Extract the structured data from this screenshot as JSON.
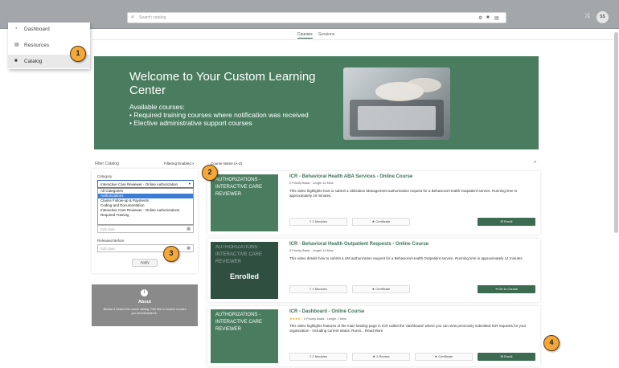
{
  "topbar": {
    "search_placeholder": "Search catalog",
    "right_icons": [
      "shuffle-icon",
      "avatar"
    ],
    "avatar_initials": "SS"
  },
  "sidebar": {
    "items": [
      {
        "label": "Dashboard",
        "icon": "dashboard-icon"
      },
      {
        "label": "Resources",
        "icon": "resources-icon"
      },
      {
        "label": "Catalog",
        "icon": "folder-icon"
      }
    ]
  },
  "tabs": [
    {
      "label": "Courses",
      "active": true
    },
    {
      "label": "Sessions",
      "active": false
    }
  ],
  "hero": {
    "title": "Welcome to Your Custom Learning Center",
    "subtitle": "Available courses:",
    "bullets": [
      "• Required training courses where notification was received",
      "• Elective administrative support courses"
    ]
  },
  "filter": {
    "title": "Filter Catalog",
    "filtering_label": "Filtering Enabled",
    "sort_label": "Course Name (A-Z)",
    "category_label": "Category",
    "selected_category": "Interactive Care Reviewer - Online Authorization",
    "options": [
      "All Categories",
      "Authorizations",
      "Claims Follow-up & Payments",
      "Coding and Documentation",
      "Interactive Care Reviewer - Online Authorizations",
      "Required Training"
    ],
    "highlighted_option": 1,
    "date_placeholder_1": "Edit date",
    "released_before_label": "Released Before",
    "date_placeholder_2": "Edit date",
    "apply_label": "Apply"
  },
  "about": {
    "title": "About",
    "description": "Browse & Search the course catalog. Feel free to enroll in courses you are interested in."
  },
  "courses": [
    {
      "thumb_text": "AUTHORIZATIONS - INTERACTIVE CARE REVIEWER",
      "title": "ICR - Behavioral Health ABA Services - Online Course",
      "meta": "0 Priority Basis  ·  Length 10 Mins",
      "stars": "",
      "description": "This video highlights how to submit a Utilization Management authorization request for a Behavioral Health Outpatient service. Running time is approximately 10 minutes.",
      "buttons": [
        "≡ 2 Modules",
        "★ Certificate"
      ],
      "action": "✉ Enroll",
      "enrolled": false
    },
    {
      "thumb_text": "AUTHORIZATIONS - INTERACTIVE CARE REVIEWER",
      "title": "ICR - Behavioral Health Outpatient Requests - Online Course",
      "meta": "0 Priority Basis  ·  Length 14 Mins",
      "stars": "",
      "description": "This video details how to submit a UM authorization request for a Behavioral Health Outpatient service. Running time is approximately 14 minutes.",
      "buttons": [
        "≡ 4 Modules",
        "★ Certificate"
      ],
      "action": "➜ Go to Course",
      "enrolled": true,
      "enrolled_label": "Enrolled"
    },
    {
      "thumb_text": "AUTHORIZATIONS - INTERACTIVE CARE REVIEWER",
      "title": "ICR - Dashboard - Online Course",
      "meta": "0 Priority Basis  ·  Length 7 Mins",
      "stars": "★★★★☆",
      "description": "This video highlights features of the main landing page in ICR called the 'dashboard' where you can view previously submitted ICR requests for your organization - including current status. Runni... Read More",
      "buttons": [
        "≡ 2 Modules",
        "★ 1 Review",
        "★ Certificate"
      ],
      "action": "✉ Enroll",
      "enrolled": false
    }
  ],
  "callouts": [
    "1",
    "2",
    "3",
    "4"
  ],
  "colors": {
    "brand_green": "#4a7d5f",
    "callout_orange": "#f4a83a",
    "enroll_green": "#3d6b52"
  }
}
